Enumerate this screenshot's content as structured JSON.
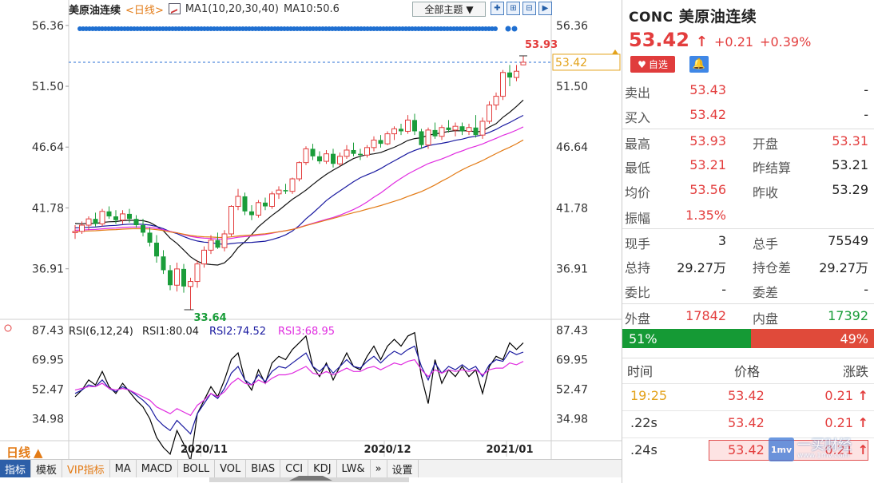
{
  "instrument": {
    "symbol_name": "美原油连续",
    "period_label": "日线",
    "ma_legend_prefix": "MA1(10,20,30,40)",
    "ma_legend_value": "MA10:50.6",
    "theme_button": "全部主题"
  },
  "main_chart": {
    "y_tick_labels": [
      "56.36",
      "51.50",
      "46.64",
      "41.78",
      "36.91"
    ],
    "y_ticks": [
      56.36,
      51.5,
      46.64,
      41.78,
      36.91
    ],
    "high_label": "53.93",
    "low_label": "33.64",
    "current_label": "53.42",
    "date_labels": [
      "2020/11",
      "2020/12",
      "2021/01"
    ]
  },
  "rsi_panel": {
    "title": "RSI(6,12,24)",
    "rsi1": "RSI1:80.04",
    "rsi2": "RSI2:74.52",
    "rsi3": "RSI3:68.95",
    "y_tick_labels": [
      "87.43",
      "69.95",
      "52.47",
      "34.98"
    ],
    "y_ticks": [
      87.43,
      69.95,
      52.47,
      34.98
    ]
  },
  "chart_data": {
    "type": "candlestick",
    "price_ylim": [
      33.0,
      57.5
    ],
    "candles": [
      [
        39.8,
        40.4,
        39.3,
        39.9
      ],
      [
        39.9,
        40.7,
        39.7,
        40.4
      ],
      [
        40.4,
        41.1,
        40.0,
        40.9
      ],
      [
        40.9,
        41.4,
        40.3,
        40.5
      ],
      [
        40.5,
        41.7,
        40.3,
        41.5
      ],
      [
        41.5,
        41.9,
        40.9,
        41.1
      ],
      [
        41.1,
        41.6,
        40.5,
        40.8
      ],
      [
        40.8,
        41.6,
        40.5,
        41.3
      ],
      [
        41.3,
        41.7,
        40.6,
        40.9
      ],
      [
        40.9,
        41.2,
        40.2,
        40.4
      ],
      [
        40.4,
        40.9,
        39.5,
        39.8
      ],
      [
        39.8,
        40.2,
        38.7,
        39.0
      ],
      [
        39.0,
        39.6,
        37.4,
        37.9
      ],
      [
        37.9,
        38.4,
        36.5,
        36.8
      ],
      [
        36.8,
        37.2,
        35.2,
        35.6
      ],
      [
        35.6,
        37.4,
        35.1,
        36.9
      ],
      [
        36.9,
        37.3,
        35.0,
        35.5
      ],
      [
        35.5,
        36.2,
        33.64,
        35.9
      ],
      [
        35.9,
        37.6,
        35.4,
        37.3
      ],
      [
        37.3,
        38.7,
        37.0,
        38.4
      ],
      [
        38.4,
        39.6,
        38.1,
        39.2
      ],
      [
        39.2,
        39.8,
        38.5,
        38.6
      ],
      [
        38.6,
        40.0,
        38.3,
        39.7
      ],
      [
        39.7,
        42.0,
        39.5,
        41.9
      ],
      [
        41.9,
        43.3,
        41.6,
        42.7
      ],
      [
        42.7,
        43.0,
        41.2,
        41.5
      ],
      [
        41.5,
        42.0,
        40.8,
        41.2
      ],
      [
        41.2,
        42.4,
        41.0,
        42.2
      ],
      [
        42.2,
        42.6,
        41.6,
        41.9
      ],
      [
        41.9,
        43.1,
        41.7,
        42.9
      ],
      [
        42.9,
        43.5,
        42.5,
        43.2
      ],
      [
        43.2,
        43.7,
        42.9,
        43.1
      ],
      [
        43.1,
        44.2,
        42.9,
        44.1
      ],
      [
        44.1,
        45.5,
        43.9,
        45.4
      ],
      [
        45.4,
        46.7,
        45.2,
        46.5
      ],
      [
        46.5,
        46.9,
        45.6,
        45.9
      ],
      [
        45.9,
        46.3,
        45.3,
        45.5
      ],
      [
        45.5,
        46.4,
        45.3,
        46.1
      ],
      [
        46.1,
        46.5,
        45.0,
        45.3
      ],
      [
        45.3,
        46.2,
        45.1,
        45.9
      ],
      [
        45.9,
        46.8,
        45.7,
        46.4
      ],
      [
        46.4,
        47.0,
        45.9,
        46.1
      ],
      [
        46.1,
        46.5,
        45.6,
        46.0
      ],
      [
        46.0,
        46.8,
        45.8,
        46.6
      ],
      [
        46.6,
        47.5,
        46.3,
        47.2
      ],
      [
        47.2,
        47.6,
        46.6,
        46.9
      ],
      [
        46.9,
        47.9,
        46.8,
        47.7
      ],
      [
        47.7,
        48.3,
        47.2,
        48.1
      ],
      [
        48.1,
        48.5,
        47.6,
        47.9
      ],
      [
        47.9,
        49.2,
        47.7,
        48.8
      ],
      [
        48.8,
        49.3,
        47.6,
        47.9
      ],
      [
        47.9,
        48.1,
        46.5,
        46.8
      ],
      [
        46.8,
        48.2,
        46.5,
        48.0
      ],
      [
        48.0,
        48.6,
        47.3,
        47.5
      ],
      [
        47.5,
        48.4,
        47.2,
        48.2
      ],
      [
        48.2,
        48.8,
        47.8,
        48.0
      ],
      [
        48.0,
        48.6,
        47.5,
        48.3
      ],
      [
        48.3,
        48.6,
        47.6,
        47.9
      ],
      [
        47.9,
        48.5,
        47.6,
        48.2
      ],
      [
        48.2,
        49.2,
        47.4,
        47.6
      ],
      [
        47.6,
        49.0,
        47.3,
        48.7
      ],
      [
        48.7,
        50.3,
        48.5,
        50.0
      ],
      [
        50.0,
        51.0,
        49.6,
        50.7
      ],
      [
        50.7,
        52.8,
        50.4,
        52.6
      ],
      [
        52.6,
        53.2,
        51.5,
        52.2
      ],
      [
        52.2,
        53.2,
        51.9,
        52.7
      ],
      [
        53.21,
        53.93,
        53.21,
        53.42
      ]
    ],
    "rsi_ylim": [
      22.0,
      92.0
    ],
    "series": [
      {
        "name": "RSI1",
        "color": "#000000",
        "values": [
          48,
          52,
          58,
          55,
          63,
          54,
          50,
          56,
          51,
          46,
          42,
          35,
          24,
          18,
          14,
          28,
          20,
          10,
          38,
          46,
          54,
          48,
          58,
          70,
          74,
          58,
          52,
          64,
          56,
          68,
          72,
          70,
          76,
          80,
          84,
          66,
          60,
          68,
          58,
          66,
          74,
          66,
          64,
          72,
          78,
          70,
          78,
          82,
          78,
          84,
          86,
          60,
          44,
          70,
          56,
          64,
          60,
          66,
          60,
          64,
          50,
          66,
          72,
          70,
          80,
          76,
          80
        ]
      },
      {
        "name": "RSI2",
        "color": "#1a1aa0",
        "values": [
          50,
          52,
          55,
          54,
          58,
          53,
          51,
          54,
          52,
          49,
          46,
          42,
          35,
          31,
          28,
          34,
          30,
          26,
          38,
          44,
          50,
          47,
          53,
          62,
          66,
          58,
          55,
          61,
          57,
          63,
          66,
          65,
          68,
          71,
          74,
          66,
          63,
          67,
          62,
          66,
          70,
          66,
          65,
          69,
          72,
          68,
          72,
          75,
          73,
          76,
          78,
          66,
          58,
          68,
          62,
          66,
          64,
          67,
          64,
          66,
          60,
          67,
          70,
          69,
          75,
          73,
          74.52
        ]
      },
      {
        "name": "RSI3",
        "color": "#e02ce0",
        "values": [
          52,
          53,
          54,
          54,
          56,
          53,
          52,
          53,
          52,
          50,
          48,
          46,
          42,
          40,
          38,
          41,
          39,
          37,
          43,
          46,
          50,
          48,
          51,
          56,
          59,
          56,
          55,
          58,
          56,
          59,
          61,
          61,
          62,
          64,
          66,
          62,
          61,
          63,
          61,
          63,
          65,
          63,
          63,
          65,
          66,
          64,
          66,
          68,
          67,
          69,
          70,
          64,
          60,
          64,
          62,
          64,
          63,
          64,
          63,
          64,
          61,
          64,
          65,
          65,
          68,
          67,
          68.95
        ]
      }
    ]
  },
  "right_panel": {
    "code": "CONC",
    "name": "美原油连续",
    "last_price": "53.42",
    "change": "+0.21",
    "change_pct": "+0.39%",
    "fav_label": "自选",
    "quotes": [
      {
        "l1": "卖出",
        "v1": "53.43",
        "l2": "",
        "v2": "-"
      },
      {
        "l1": "买入",
        "v1": "53.42",
        "l2": "",
        "v2": "-"
      },
      {
        "l1": "最高",
        "v1": "53.93",
        "l2": "开盘",
        "v2": "53.31"
      },
      {
        "l1": "最低",
        "v1": "53.21",
        "l2": "昨结算",
        "v2": "53.21"
      },
      {
        "l1": "均价",
        "v1": "53.56",
        "l2": "昨收",
        "v2": "53.29"
      },
      {
        "l1": "振幅",
        "v1": "1.35%",
        "l2": "",
        "v2": ""
      },
      {
        "l1": "现手",
        "v1": "3",
        "l2": "总手",
        "v2": "75549"
      },
      {
        "l1": "总持",
        "v1": "29.27万",
        "l2": "持仓差",
        "v2": "29.27万"
      },
      {
        "l1": "委比",
        "v1": "-",
        "l2": "委差",
        "v2": "-"
      },
      {
        "l1": "外盘",
        "v1": "17842",
        "l2": "内盘",
        "v2": "17392"
      }
    ],
    "buy_ratio_label": "51%",
    "sell_ratio_label": "49%",
    "buy_ratio": 0.51,
    "tick_headers": {
      "time": "时间",
      "price": "价格",
      "chg": "涨跌"
    },
    "ticks": [
      {
        "time": "19:25",
        "price": "53.42",
        "chg": "0.21"
      },
      {
        "time": ".22s",
        "price": "53.42",
        "chg": "0.21"
      },
      {
        "time": ".24s",
        "price": "53.42",
        "chg": "0.21"
      }
    ],
    "watermark_text": "一买财经",
    "watermark_logo": "1mv",
    "watermark_sub": "www.1mv.com"
  },
  "bottom_bar": {
    "period_tab": "日线",
    "tabs": [
      "指标",
      "模板",
      "VIP指标",
      "MA",
      "MACD",
      "BOLL",
      "VOL",
      "BIAS",
      "CCI",
      "KDJ",
      "LW&",
      "»",
      "设置"
    ]
  },
  "colors": {
    "up": "#e33d3d",
    "down": "#1a9d3a",
    "accent": "#e37b16"
  }
}
